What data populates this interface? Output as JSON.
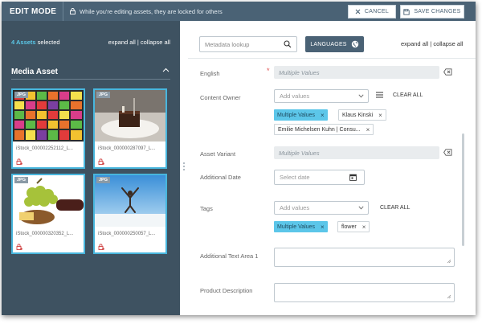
{
  "topbar": {
    "mode_title": "EDIT MODE",
    "lock_message": "While you're editing assets, they are locked for others",
    "cancel_label": "CANCEL",
    "save_label": "SAVE CHANGES"
  },
  "left": {
    "selected_count": "4 Assets",
    "selected_suffix": " selected",
    "expand_all": "expand all",
    "collapse_all": "collapse all",
    "separator": " | ",
    "section_title": "Media Asset",
    "cards": [
      {
        "badge": "JPG",
        "filename": "iStock_000002252112_L..."
      },
      {
        "badge": "JPG",
        "filename": "iStock_000000287097_L..."
      },
      {
        "badge": "JPG",
        "filename": "iStock_000000320352_L..."
      },
      {
        "badge": "JPG",
        "filename": "iStock_000000250057_L..."
      }
    ]
  },
  "right": {
    "search_placeholder": "Metadata lookup",
    "languages_label": "LANGUAGES",
    "expand_all": "expand all",
    "collapse_all": "collapse all",
    "separator": " | ",
    "fields": {
      "english": {
        "label": "English",
        "value": "Multiple Values"
      },
      "content_owner": {
        "label": "Content Owner",
        "placeholder": "Add values",
        "clear_all": "CLEAR ALL",
        "tags": [
          "Multiple Values",
          "Klaus Kinski",
          "Emilie Michelsen Kuhn | Consu..."
        ]
      },
      "asset_variant": {
        "label": "Asset Variant",
        "value": "Multiple Values"
      },
      "additional_date": {
        "label": "Additional Date",
        "placeholder": "Select date"
      },
      "tags": {
        "label": "Tags",
        "placeholder": "Add values",
        "clear_all": "CLEAR ALL",
        "tags": [
          "Multiple Values",
          "flower"
        ]
      },
      "additional_text_area": {
        "label": "Additional Text Area 1"
      },
      "product_description": {
        "label": "Product Description"
      }
    }
  },
  "colors": {
    "topbar": "#4a6275",
    "left_panel": "#3e5261",
    "accent": "#48b6dd",
    "tag_blue": "#5cc6e9"
  }
}
